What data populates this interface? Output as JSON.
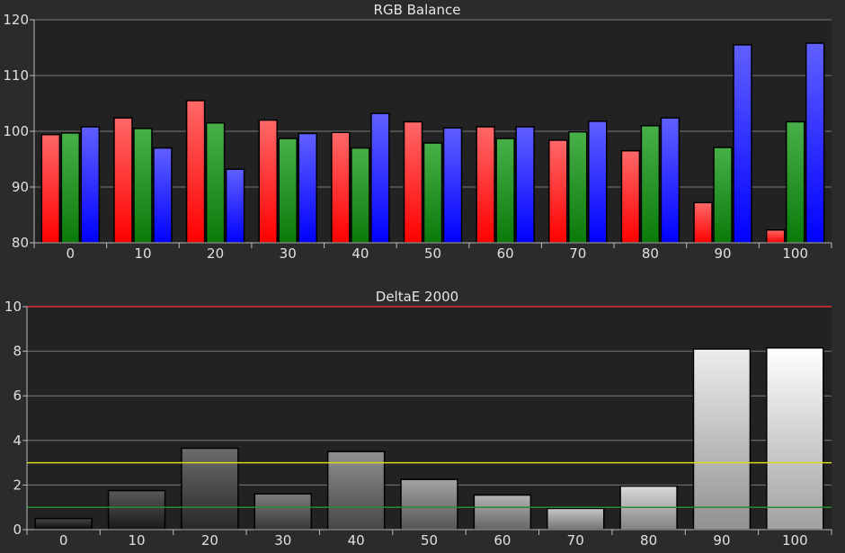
{
  "chart_data": [
    {
      "type": "bar",
      "title": "RGB Balance",
      "categories": [
        "0",
        "10",
        "20",
        "30",
        "40",
        "50",
        "60",
        "70",
        "80",
        "90",
        "100"
      ],
      "ylim": [
        80,
        120
      ],
      "yticks": [
        "80",
        "90",
        "100",
        "110",
        "120"
      ],
      "grid": true,
      "series": [
        {
          "color": "#ff2a2a",
          "values": [
            99.4,
            102.4,
            105.5,
            102.0,
            99.8,
            101.7,
            100.8,
            98.4,
            96.5,
            87.2,
            82.3
          ]
        },
        {
          "color": "#1f9a1f",
          "values": [
            99.7,
            100.5,
            101.5,
            98.7,
            97.0,
            97.9,
            98.7,
            99.9,
            101.0,
            97.1,
            101.7
          ]
        },
        {
          "color": "#2a2aff",
          "values": [
            100.8,
            97.0,
            93.2,
            99.6,
            103.2,
            100.6,
            100.8,
            101.8,
            102.4,
            115.5,
            115.8
          ]
        }
      ]
    },
    {
      "type": "bar",
      "title": "DeltaE 2000",
      "categories": [
        "0",
        "10",
        "20",
        "30",
        "40",
        "50",
        "60",
        "70",
        "80",
        "90",
        "100"
      ],
      "ylim": [
        0,
        10
      ],
      "yticks": [
        "0",
        "2",
        "4",
        "6",
        "8",
        "10"
      ],
      "grid": true,
      "values": [
        0.5,
        1.75,
        3.65,
        1.6,
        3.5,
        2.25,
        1.55,
        0.95,
        1.95,
        8.1,
        8.15
      ],
      "reference_lines": [
        {
          "value": 10,
          "color": "#e03030"
        },
        {
          "value": 3,
          "color": "#d8d820"
        },
        {
          "value": 1,
          "color": "#2a8a2a"
        }
      ]
    }
  ]
}
